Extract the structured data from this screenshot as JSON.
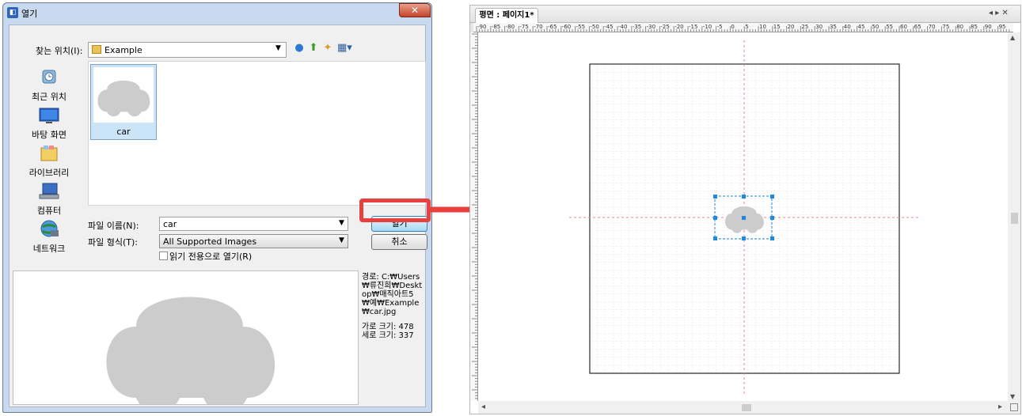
{
  "dialog": {
    "title": "열기",
    "app_icon": "app-icon",
    "close_label": "✕",
    "look_in_label": "찾는 위치(I):",
    "look_in_value": "Example",
    "toolbar_icons": [
      "back-icon",
      "up-folder-icon",
      "new-folder-icon",
      "view-menu-icon"
    ],
    "places": [
      {
        "label": "최근 위치",
        "icon": "recent-places-icon"
      },
      {
        "label": "바탕 화면",
        "icon": "desktop-icon"
      },
      {
        "label": "라이브러리",
        "icon": "libraries-icon"
      },
      {
        "label": "컴퓨터",
        "icon": "computer-icon"
      },
      {
        "label": "네트워크",
        "icon": "network-icon"
      }
    ],
    "files": [
      {
        "name": "car"
      }
    ],
    "file_name_label": "파일 이름(N):",
    "file_name_value": "car",
    "file_type_label": "파일 형식(T):",
    "file_type_value": "All Supported Images",
    "readonly_label": "읽기 전용으로 열기(R)",
    "readonly_checked": false,
    "open_button": "열기",
    "cancel_button": "취소",
    "info": {
      "path": "경로: C:₩Users₩류진희₩Desktop₩매직아트5₩예₩Example₩car.jpg",
      "width": "가로 크기: 478",
      "height": "세로 크기: 337"
    }
  },
  "editor": {
    "tab_label": "평면 : 페이지1*",
    "tab_nav": "◂ ▸ ✕",
    "ruler_ticks": [
      "-90",
      "-85",
      "-80",
      "-75",
      "-70",
      "-65",
      "-60",
      "-55",
      "-50",
      "-45",
      "-40",
      "-35",
      "-30",
      "-25",
      "-20",
      "-15",
      "-10",
      "-5",
      "0",
      "5",
      "10",
      "15",
      "20",
      "25",
      "30",
      "35",
      "40",
      "45",
      "50",
      "55",
      "60",
      "65",
      "70",
      "75",
      "80",
      "85",
      "90",
      "95"
    ]
  },
  "colors": {
    "arrow": "#e8403e",
    "selection": "#1e88e5",
    "car_shape": "#cccccc",
    "guide_line": "#f08080"
  }
}
